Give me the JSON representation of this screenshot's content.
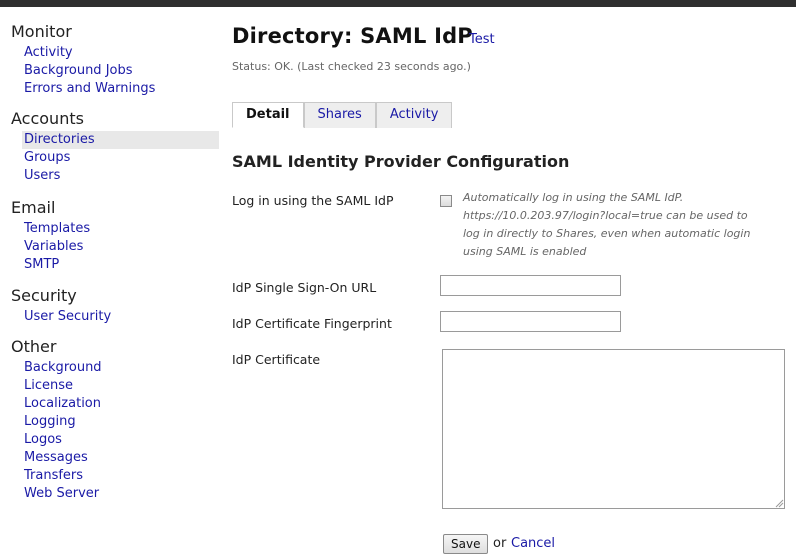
{
  "sidebar": {
    "sections": [
      {
        "title": "Monitor",
        "items": [
          "Activity",
          "Background Jobs",
          "Errors and Warnings"
        ]
      },
      {
        "title": "Accounts",
        "items": [
          "Directories",
          "Groups",
          "Users"
        ]
      },
      {
        "title": "Email",
        "items": [
          "Templates",
          "Variables",
          "SMTP"
        ]
      },
      {
        "title": "Security",
        "items": [
          "User Security"
        ]
      },
      {
        "title": "Other",
        "items": [
          "Background",
          "License",
          "Localization",
          "Logging",
          "Logos",
          "Messages",
          "Transfers",
          "Web Server"
        ]
      }
    ],
    "active_item": "Directories"
  },
  "header": {
    "title": "Directory: SAML IdP",
    "test_link": "Test",
    "status": "Status: OK. (Last checked 23 seconds ago.)"
  },
  "tabs": [
    {
      "label": "Detail",
      "selected": true
    },
    {
      "label": "Shares",
      "selected": false
    },
    {
      "label": "Activity",
      "selected": false
    }
  ],
  "form": {
    "heading": "SAML Identity Provider Configuration",
    "login_label": "Log in using the SAML IdP",
    "login_checked": false,
    "login_help": "Automatically log in using the SAML IdP. https://10.0.203.97/login?local=true can be used to log in directly to Shares, even when automatic login using SAML is enabled",
    "sso_label": "IdP Single Sign-On URL",
    "sso_value": "",
    "fingerprint_label": "IdP Certificate Fingerprint",
    "fingerprint_value": "",
    "certificate_label": "IdP Certificate",
    "certificate_value": ""
  },
  "actions": {
    "save_label": "Save",
    "or_text": "or",
    "cancel_label": "Cancel"
  },
  "colors": {
    "link": "#1a1aa6",
    "topbar": "#2f2f2f",
    "active_bg": "#e8e8e8"
  }
}
